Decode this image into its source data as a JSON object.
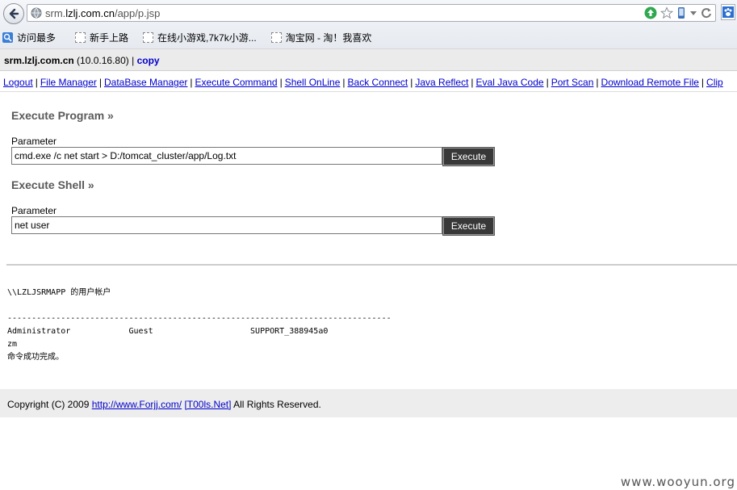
{
  "browser": {
    "url_prefix": "srm.",
    "url_domain": "lzlj.com.cn",
    "url_path": "/app/p.jsp",
    "bookmarks": [
      {
        "label": "访问最多"
      },
      {
        "label": "新手上路"
      },
      {
        "label": "在线小游戏,7k7k小游..."
      },
      {
        "label": "淘宝网 - 淘！我喜欢"
      }
    ]
  },
  "host": {
    "name": "srm.lzlj.com.cn",
    "ip": "(10.0.16.80)",
    "sep": "|",
    "copy_label": "copy"
  },
  "nav": {
    "items": [
      "Logout",
      "File Manager",
      "DataBase Manager",
      "Execute Command",
      "Shell OnLine",
      "Back Connect",
      "Java Reflect",
      "Eval Java Code",
      "Port Scan",
      "Download Remote File",
      "Clip"
    ],
    "separator": "|"
  },
  "execute_program": {
    "title": "Execute Program »",
    "param_label": "Parameter",
    "value": "cmd.exe /c net start > D:/tomcat_cluster/app/Log.txt",
    "button": "Execute"
  },
  "execute_shell": {
    "title": "Execute Shell »",
    "param_label": "Parameter",
    "value": "net user",
    "button": "Execute"
  },
  "output": {
    "lines": [
      "\\\\LZLJSRMAPP 的用户帐户",
      "",
      "-------------------------------------------------------------------------------",
      "Administrator            Guest                    SUPPORT_388945a0",
      "zm",
      "命令成功完成。"
    ]
  },
  "footer": {
    "prefix": "Copyright (C) 2009",
    "link1": "http://www.Forjj.com/",
    "link2": "[T00ls.Net]",
    "suffix": "All Rights Reserved."
  },
  "watermark": "www.wooyun.org",
  "colors": {
    "link": "#0000cc",
    "section_title": "#5a5a5a",
    "button_bg": "#383838"
  }
}
